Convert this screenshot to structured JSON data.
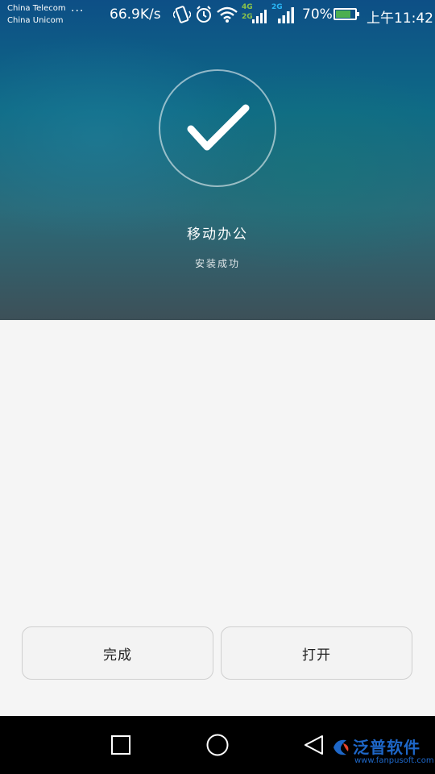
{
  "status_bar": {
    "carrier_1": "China Telecom",
    "carrier_2": "China Unicom",
    "more_dots": "···",
    "network_speed": "66.9K/s",
    "network_1_label_top": "4G",
    "network_1_label_bottom": "2G",
    "network_2_label": "2G",
    "battery_percent": "70%",
    "battery_level": 0.7,
    "battery_fill_color": "#4caf50",
    "time": "上午11:42",
    "icons": [
      "vibrate-icon",
      "alarm-icon",
      "wifi-icon",
      "cell-signal-icon",
      "battery-icon"
    ]
  },
  "hero": {
    "icon": "checkmark-icon",
    "app_name": "移动办公",
    "status_text": "安装成功"
  },
  "buttons": {
    "done_label": "完成",
    "open_label": "打开"
  },
  "nav_bar": {
    "icons": [
      "recent-apps-icon",
      "home-icon",
      "back-icon"
    ]
  },
  "watermark": {
    "title": "泛普软件",
    "url": "www.fanpusoft.com"
  },
  "colors": {
    "hero_top": "#0d4f86",
    "hero_bottom": "#3d5058",
    "page_bg": "#f5f5f5",
    "nav_bg": "#000000",
    "watermark": "#1e67c8"
  }
}
